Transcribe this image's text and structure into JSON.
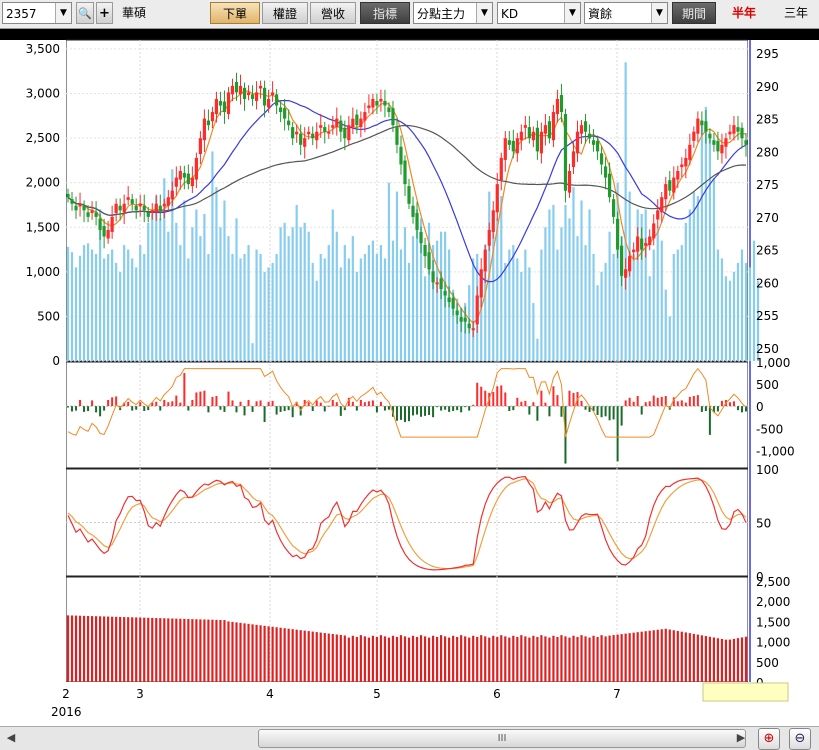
{
  "toolbar": {
    "stock_code": "2357",
    "stock_name": "華碩",
    "buttons": [
      "下單",
      "權證",
      "營收"
    ],
    "indicator_label": "指標",
    "indicator_main": "分點主力",
    "indicator_sub": "KD",
    "indicator_third": "資餘",
    "period_label": "期間",
    "period_selected": "半年",
    "period_other": "三年"
  },
  "colors": {
    "up": "#ff2a2a",
    "down": "#1f9a2c",
    "volume": "#87cdf0",
    "ma_short": "#f08a24",
    "ma_mid": "#3a3ae0",
    "ma_long": "#555555",
    "k_line": "#f23030",
    "d_line": "#f2a040",
    "margin_bar": "#e02020"
  },
  "chart_data": [
    {
      "type": "candlestick",
      "panel": "price-volume",
      "x_tick_labels": [
        "2",
        "3",
        "4",
        "5",
        "6",
        "7"
      ],
      "x_year_label": "2016",
      "price_axis": {
        "range": [
          248,
          297
        ],
        "ticks": [
          "250",
          "255",
          "260",
          "265",
          "270",
          "275",
          "280",
          "285",
          "290",
          "295"
        ]
      },
      "volume_axis": {
        "range": [
          0,
          3600
        ],
        "ticks": [
          "0",
          "500",
          "1,000",
          "1,500",
          "2,000",
          "2,500",
          "3,000",
          "3,500"
        ]
      },
      "close": [
        273,
        272,
        271,
        272,
        271,
        270,
        271,
        270,
        268,
        267,
        268,
        270,
        272,
        271,
        272,
        273,
        272,
        271,
        272,
        271,
        270,
        271,
        272,
        271,
        272,
        273,
        274,
        276,
        277,
        276,
        275,
        276,
        279,
        282,
        285,
        284,
        286,
        288,
        287,
        286,
        289,
        290,
        289,
        290,
        288,
        289,
        288,
        289,
        290,
        287,
        288,
        289,
        287,
        286,
        285,
        284,
        282,
        283,
        281,
        282,
        283,
        282,
        283,
        284,
        283,
        283,
        284,
        285,
        283,
        282,
        284,
        285,
        284,
        285,
        286,
        287,
        288,
        287,
        288,
        287,
        286,
        284,
        281,
        278,
        275,
        272,
        270,
        268,
        266,
        264,
        262,
        260,
        260,
        259,
        258,
        257,
        256,
        255,
        254,
        254,
        253,
        253,
        258,
        262,
        265,
        268,
        271,
        275,
        279,
        282,
        281,
        280,
        282,
        283,
        284,
        282,
        283,
        280,
        283,
        284,
        282,
        286,
        288,
        286,
        274,
        277,
        280,
        283,
        284,
        283,
        282,
        281,
        280,
        278,
        276,
        273,
        270,
        265,
        261,
        262,
        264,
        265,
        267,
        265,
        266,
        267,
        269,
        271,
        273,
        275,
        274,
        276,
        277,
        278,
        279,
        281,
        283,
        285,
        284,
        283,
        282,
        281,
        280,
        281,
        282,
        283,
        284,
        283,
        282,
        281
      ],
      "volume": [
        1280,
        1220,
        1050,
        1180,
        1300,
        1320,
        1250,
        1200,
        1700,
        1150,
        1200,
        1250,
        1100,
        1000,
        1300,
        1250,
        1150,
        1050,
        1300,
        1200,
        1550,
        1650,
        1850,
        1600,
        2050,
        1450,
        2150,
        1550,
        1300,
        1800,
        1150,
        1500,
        1700,
        1400,
        1650,
        1200,
        2350,
        1950,
        1500,
        1800,
        1400,
        1200,
        1600,
        1150,
        1200,
        1300,
        200,
        1250,
        1200,
        1000,
        1050,
        1100,
        1200,
        1500,
        1550,
        1400,
        1500,
        1750,
        1500,
        1550,
        1450,
        1100,
        900,
        1200,
        1150,
        1300,
        1700,
        1450,
        1050,
        1300,
        1150,
        1400,
        1000,
        1150,
        1200,
        1300,
        1350,
        1200,
        1300,
        1150,
        2000,
        1350,
        1900,
        1250,
        1500,
        1100,
        1400,
        1700,
        1600,
        950,
        1550,
        1300,
        1350,
        1450,
        1450,
        1250,
        800,
        700,
        600,
        650,
        850,
        1150,
        1200,
        1000,
        1300,
        1900,
        1500,
        1600,
        1850,
        1100,
        1250,
        1300,
        1150,
        1000,
        1250,
        1050,
        650,
        250,
        1250,
        1500,
        1700,
        1750,
        1250,
        1500,
        1750,
        1600,
        1950,
        1400,
        1800,
        1300,
        1700,
        1200,
        850,
        1000,
        1100,
        1450,
        1200,
        2000,
        1400,
        3350,
        1900,
        1200,
        1700,
        1650,
        1700,
        950,
        1250,
        1500,
        1350,
        800,
        500,
        1200,
        1250,
        1300,
        1550,
        1700,
        1900,
        1850,
        2650,
        2850,
        2500,
        2050,
        1250,
        1150,
        950,
        900,
        1000,
        1100,
        1250,
        1100,
        1050,
        1350,
        900
      ],
      "series": [
        {
          "name": "MA5",
          "color_key": "ma_short"
        },
        {
          "name": "MA20",
          "color_key": "ma_mid"
        },
        {
          "name": "MA60",
          "color_key": "ma_long"
        }
      ]
    },
    {
      "type": "bar",
      "panel": "main-force",
      "axis": {
        "range": [
          -1400,
          1000
        ],
        "ticks": [
          "1,000",
          "500",
          "0",
          "-500",
          "-1,000"
        ]
      },
      "note": "net buy/sell bars with cumulative line"
    },
    {
      "type": "line",
      "panel": "kd",
      "axis": {
        "range": [
          0,
          100
        ],
        "ticks": [
          "100",
          "50",
          "0"
        ]
      }
    },
    {
      "type": "bar",
      "panel": "margin-balance",
      "axis": {
        "range": [
          0,
          2600
        ],
        "ticks": [
          "2,500",
          "2,000",
          "1,500",
          "1,000",
          "500",
          "0"
        ]
      }
    }
  ],
  "scrollbar": {
    "grip": "III"
  }
}
